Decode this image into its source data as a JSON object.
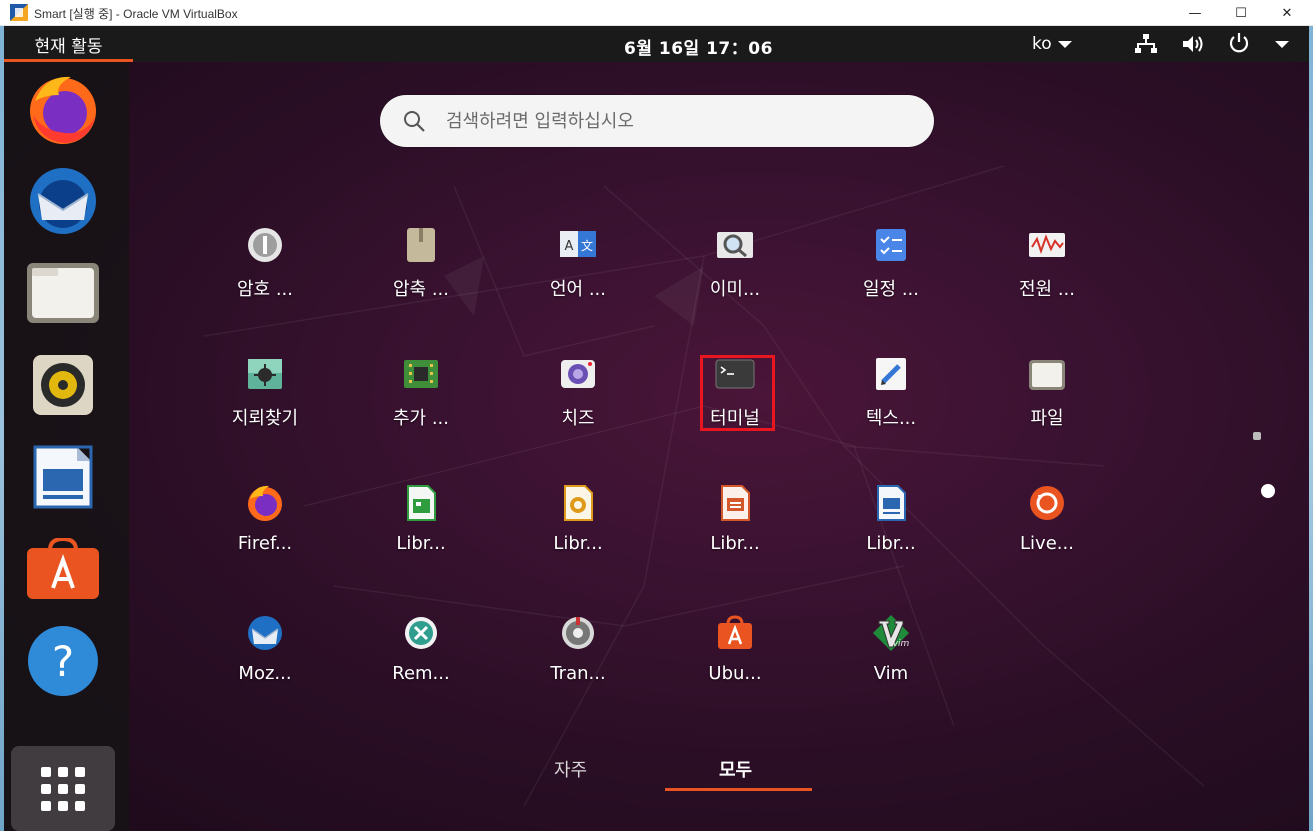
{
  "window": {
    "title": "Smart [실행 중] - Oracle VM VirtualBox",
    "minimize_glyph": "—",
    "maximize_glyph": "☐",
    "close_glyph": "✕"
  },
  "topbar": {
    "activities": "현재 활동",
    "clock": "6월 16일  17：06",
    "language": "ko"
  },
  "dock": {
    "items": [
      {
        "name": "Firefox",
        "icon": "firefox-icon"
      },
      {
        "name": "Thunderbird",
        "icon": "thunderbird-icon"
      },
      {
        "name": "Files",
        "icon": "files-icon"
      },
      {
        "name": "Rhythmbox",
        "icon": "rhythmbox-icon"
      },
      {
        "name": "LibreOffice Writer",
        "icon": "writer-icon"
      },
      {
        "name": "Ubuntu Software",
        "icon": "software-icon"
      },
      {
        "name": "Help",
        "icon": "help-icon",
        "glyph": "?"
      }
    ],
    "show_apps_icon": "grid-icon"
  },
  "search": {
    "placeholder": "검색하려면 입력하십시오"
  },
  "apps": [
    {
      "label": "암호 ...",
      "icon": "password-icon"
    },
    {
      "label": "압축 ...",
      "icon": "archive-icon"
    },
    {
      "label": "언어 ...",
      "icon": "language-icon"
    },
    {
      "label": "이미...",
      "icon": "image-viewer-icon"
    },
    {
      "label": "일정 ...",
      "icon": "calendar-icon"
    },
    {
      "label": "전원 ...",
      "icon": "power-stats-icon"
    },
    {
      "label": "지뢰찾기",
      "icon": "mines-icon"
    },
    {
      "label": "추가 ...",
      "icon": "drivers-icon"
    },
    {
      "label": "치즈",
      "icon": "cheese-icon"
    },
    {
      "label": "터미널",
      "icon": "terminal-icon"
    },
    {
      "label": "텍스...",
      "icon": "text-editor-icon"
    },
    {
      "label": "파일",
      "icon": "files-icon"
    },
    {
      "label": "Firef...",
      "icon": "firefox-icon"
    },
    {
      "label": "Libr...",
      "icon": "calc-icon"
    },
    {
      "label": "Libr...",
      "icon": "draw-icon"
    },
    {
      "label": "Libr...",
      "icon": "impress-icon"
    },
    {
      "label": "Libr...",
      "icon": "writer-icon"
    },
    {
      "label": "Live...",
      "icon": "livepatch-icon"
    },
    {
      "label": "Moz...",
      "icon": "thunderbird-icon"
    },
    {
      "label": "Rem...",
      "icon": "remmina-icon"
    },
    {
      "label": "Tran...",
      "icon": "transmission-icon"
    },
    {
      "label": "Ubu...",
      "icon": "software-icon"
    },
    {
      "label": "Vim",
      "icon": "vim-icon"
    }
  ],
  "tabs": {
    "frequent": "자주",
    "all": "모두"
  },
  "colors": {
    "accent": "#e95420",
    "highlight": "#e8161e"
  }
}
